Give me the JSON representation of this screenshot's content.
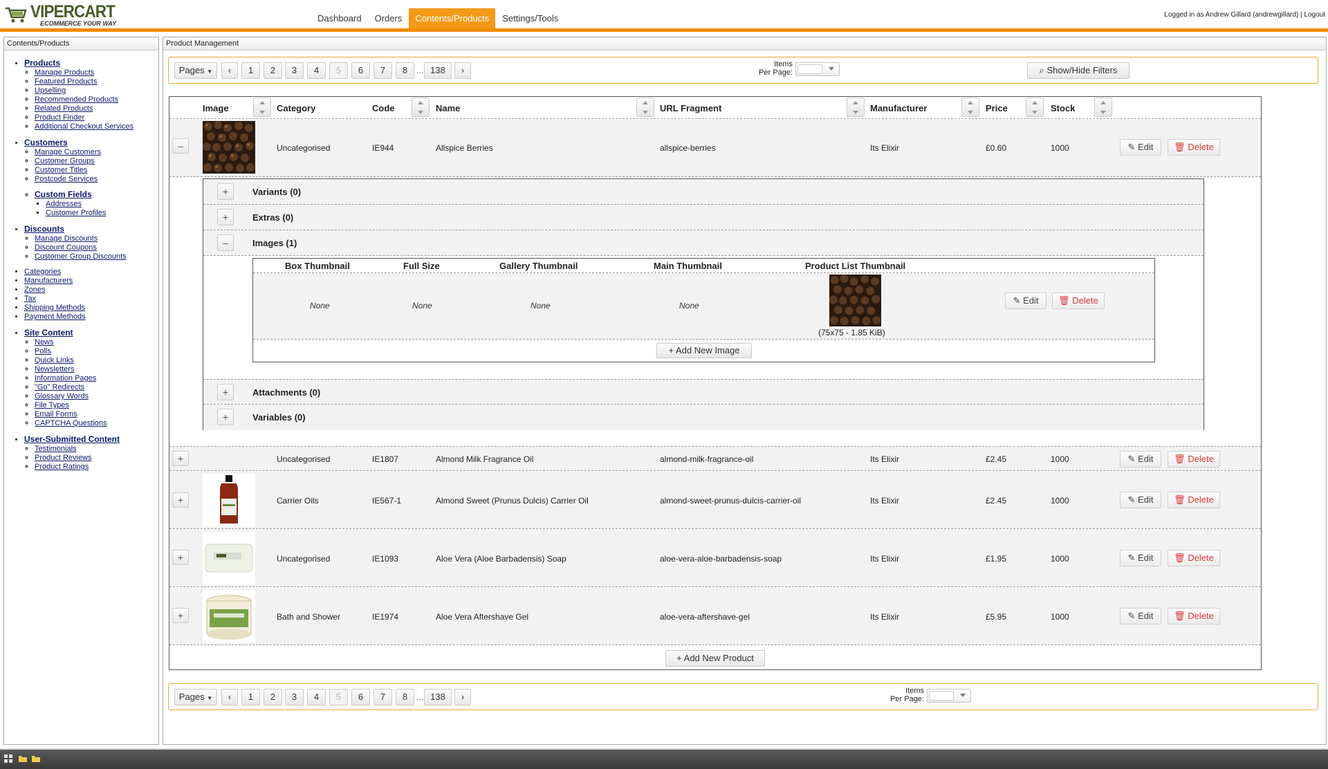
{
  "app": {
    "brand": "VIPERCART",
    "tagline": "ECOMMERCE YOUR WAY",
    "user_info": "Logged in as Andrew Gillard (andrewgillard) | Logout"
  },
  "nav": {
    "items": [
      "Dashboard",
      "Orders",
      "Contents/Products",
      "Settings/Tools"
    ],
    "active": "Contents/Products"
  },
  "sidebar": {
    "title": "Contents/Products",
    "products": {
      "label": "Products",
      "items": [
        "Manage Products",
        "Featured Products",
        "Upselling",
        "Recommended Products",
        "Related Products",
        "Product Finder",
        "Additional Checkout Services"
      ]
    },
    "customers": {
      "label": "Customers",
      "items": [
        "Manage Customers",
        "Customer Groups",
        "Customer Titles",
        "Postcode Services"
      ]
    },
    "custom_fields": {
      "label": "Custom Fields",
      "items": [
        "Addresses",
        "Customer Profiles"
      ]
    },
    "discounts": {
      "label": "Discounts",
      "items": [
        "Manage Discounts",
        "Discount Coupons",
        "Customer Group Discounts"
      ]
    },
    "misc": [
      "Categories",
      "Manufacturers",
      "Zones",
      "Tax",
      "Shipping Methods",
      "Payment Methods"
    ],
    "site_content": {
      "label": "Site Content",
      "items": [
        "News",
        "Polls",
        "Quick Links",
        "Newsletters",
        "Information Pages",
        "\"Go\" Redirects",
        "Glossary Words",
        "File Types",
        "Email Forms",
        "CAPTCHA Questions"
      ]
    },
    "user_content": {
      "label": "User-Submitted Content",
      "items": [
        "Testimonials",
        "Product Reviews",
        "Product Ratings"
      ]
    }
  },
  "main": {
    "title": "Product Management"
  },
  "pager": {
    "pages_label": "Pages",
    "prev": "‹",
    "next": "›",
    "pages": [
      "1",
      "2",
      "3",
      "4",
      "5",
      "6",
      "7",
      "8"
    ],
    "current": "5",
    "ellipsis": "...",
    "last": "138",
    "items_label_1": "Items",
    "items_label_2": "Per Page:",
    "filters_label": "⌕ Show/Hide Filters"
  },
  "columns": [
    "Image",
    "Category",
    "Code",
    "Name",
    "URL Fragment",
    "Manufacturer",
    "Price",
    "Stock"
  ],
  "products": [
    {
      "category": "Uncategorised",
      "code": "IE944",
      "name": "Allspice Berries",
      "url": "allspice-berries",
      "manufacturer": "Its Elixir",
      "price": "£0.60",
      "stock": "1000",
      "toggle": "–"
    },
    {
      "category": "Uncategorised",
      "code": "IE1807",
      "name": "Almond Milk Fragrance Oil",
      "url": "almond-milk-fragrance-oil",
      "manufacturer": "Its Elixir",
      "price": "£2.45",
      "stock": "1000",
      "toggle": "+"
    },
    {
      "category": "Carrier Oils",
      "code": "IE567-1",
      "name": "Almond Sweet (Prunus Dulcis) Carrier Oil",
      "url": "almond-sweet-prunus-dulcis-carrier-oil",
      "manufacturer": "Its Elixir",
      "price": "£2.45",
      "stock": "1000",
      "toggle": "+"
    },
    {
      "category": "Uncategorised",
      "code": "IE1093",
      "name": "Aloe Vera (Aloe Barbadensis) Soap",
      "url": "aloe-vera-aloe-barbadensis-soap",
      "manufacturer": "Its Elixir",
      "price": "£1.95",
      "stock": "1000",
      "toggle": "+"
    },
    {
      "category": "Bath and Shower",
      "code": "IE1974",
      "name": "Aloe Vera Aftershave Gel",
      "url": "aloe-vera-aftershave-gel",
      "manufacturer": "Its Elixir",
      "price": "£5.95",
      "stock": "1000",
      "toggle": "+"
    }
  ],
  "actions": {
    "edit": "Edit",
    "delete": "Delete",
    "add_product": "+ Add New Product",
    "add_image": "+ Add New Image"
  },
  "detail": {
    "sections": [
      {
        "label": "Variants (0)",
        "toggle": "+"
      },
      {
        "label": "Extras (0)",
        "toggle": "+"
      },
      {
        "label": "Images (1)",
        "toggle": "–"
      },
      {
        "label": "Attachments (0)",
        "toggle": "+"
      },
      {
        "label": "Variables (0)",
        "toggle": "+"
      }
    ],
    "image_columns": [
      "Box Thumbnail",
      "Full Size",
      "Gallery Thumbnail",
      "Main Thumbnail",
      "Product List Thumbnail"
    ],
    "image_values": [
      "None",
      "None",
      "None",
      "None"
    ],
    "image_caption": "(75x75 - 1.85 KiB)"
  },
  "colors": {
    "accent": "#f49a17",
    "delete": "#d93a3a",
    "link": "#0a1a6c"
  }
}
